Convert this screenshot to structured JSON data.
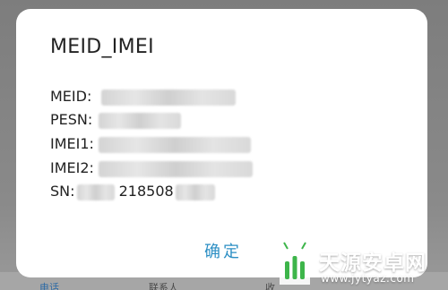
{
  "background_tabs": [
    "电话",
    "联系人",
    "收"
  ],
  "dialog": {
    "title": "MEID_IMEI",
    "rows": [
      {
        "label": "MEID:",
        "value": ""
      },
      {
        "label": "PESN:",
        "value": ""
      },
      {
        "label": "IMEI1:",
        "value": ""
      },
      {
        "label": "IMEI2:",
        "value": ""
      },
      {
        "label": "SN:",
        "value": "218508"
      }
    ],
    "confirm_label": "确定"
  },
  "watermark": {
    "name": "天源安卓网",
    "url": "www.jytyaz.com"
  },
  "colors": {
    "accent": "#2d8fc4",
    "logo_green": "#3db54a",
    "dim_overlay": "#8a8a8a"
  }
}
